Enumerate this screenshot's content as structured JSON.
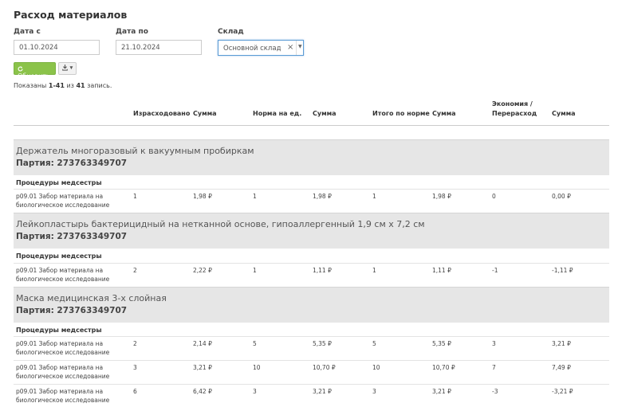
{
  "page": {
    "title": "Расход материалов"
  },
  "filters": {
    "date_from": {
      "label": "Дата с",
      "value": "01.10.2024"
    },
    "date_to": {
      "label": "Дата по",
      "value": "21.10.2024"
    },
    "warehouse": {
      "label": "Склад",
      "value": "Основной склад",
      "clear": "×",
      "caret": "▼"
    }
  },
  "toolbar": {
    "refresh_icon": "refresh-icon",
    "refresh_label": "Обновить",
    "export_icon": "download-icon",
    "export_caret": "▼"
  },
  "summary": {
    "prefix": "Показаны",
    "range": "1-41",
    "of": "из",
    "total": "41",
    "suffix": "запись."
  },
  "table": {
    "headers": [
      "Израсходовано",
      "Сумма",
      "Норма на ед.",
      "Сумма",
      "Итого по норме",
      "Сумма",
      "Экономия /",
      "Перерасход",
      "Сумма"
    ],
    "groups": [
      {
        "name": "Держатель многоразовый к вакуумным пробиркам",
        "party": "Партия: 273763349707",
        "subheading": "Процедуры медсестры",
        "rows": [
          {
            "proc1": "p09.01 Забор материала на",
            "proc2": "биологическое исследование",
            "cells": [
              "1",
              "1,98 ₽",
              "1",
              "1,98 ₽",
              "1",
              "1,98 ₽",
              "0",
              "0,00 ₽"
            ]
          }
        ]
      },
      {
        "name": "Лейкопластырь бактерицидный на нетканной основе, гипоаллергенный 1,9 см х 7,2 см",
        "party": "Партия: 273763349707",
        "subheading": "Процедуры медсестры",
        "rows": [
          {
            "proc1": "p09.01 Забор материала на",
            "proc2": "биологическое исследование",
            "cells": [
              "2",
              "2,22 ₽",
              "1",
              "1,11 ₽",
              "1",
              "1,11 ₽",
              "-1",
              "-1,11 ₽"
            ]
          }
        ]
      },
      {
        "name": "Маска медицинская 3-х слойная",
        "party": "Партия: 273763349707",
        "subheading": "Процедуры медсестры",
        "rows": [
          {
            "proc1": "p09.01 Забор материала на",
            "proc2": "биологическое исследование",
            "cells": [
              "2",
              "2,14 ₽",
              "5",
              "5,35 ₽",
              "5",
              "5,35 ₽",
              "3",
              "3,21 ₽"
            ]
          },
          {
            "proc1": "p09.01 Забор материала на",
            "proc2": "биологическое исследование",
            "cells": [
              "3",
              "3,21 ₽",
              "10",
              "10,70 ₽",
              "10",
              "10,70 ₽",
              "7",
              "7,49 ₽"
            ]
          },
          {
            "proc1": "p09.01 Забор материала на",
            "proc2": "биологическое исследование",
            "cells": [
              "6",
              "6,42 ₽",
              "3",
              "3,21 ₽",
              "3",
              "3,21 ₽",
              "-3",
              "-3,21 ₽"
            ]
          }
        ]
      }
    ]
  }
}
